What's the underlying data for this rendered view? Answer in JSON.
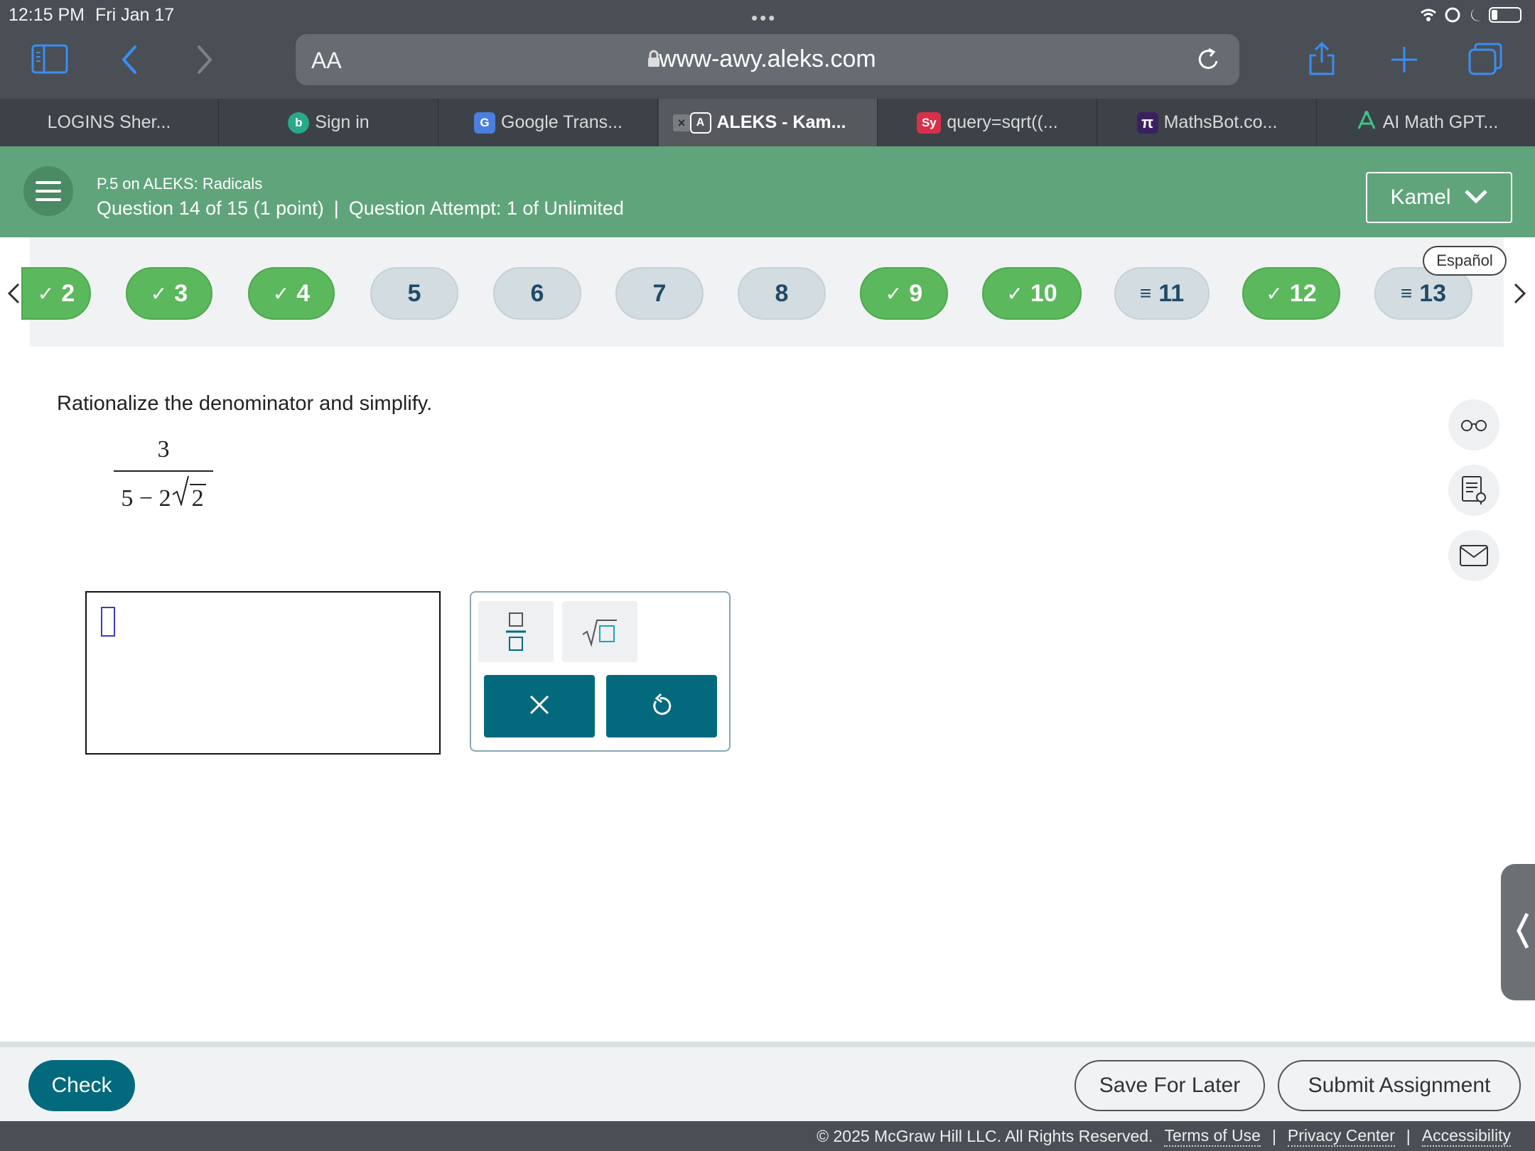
{
  "status_bar": {
    "time": "12:15 PM",
    "date": "Fri Jan 17",
    "dots": "•••"
  },
  "browser": {
    "text_size_label": "AA",
    "url": "www-awy.aleks.com",
    "tabs": [
      {
        "label": "LOGINS Sher...",
        "favicon": ""
      },
      {
        "label": "Sign in",
        "favicon": "b"
      },
      {
        "label": "Google Trans...",
        "favicon": "G"
      },
      {
        "label": "ALEKS - Kam...",
        "favicon": "A"
      },
      {
        "label": "query=sqrt((...",
        "favicon": "Sy"
      },
      {
        "label": "MathsBot.co...",
        "favicon": "π"
      },
      {
        "label": "AI Math GPT...",
        "favicon": ""
      }
    ]
  },
  "header": {
    "subtitle": "P.5 on ALEKS: Radicals",
    "question": "Question 14 of 15 (1 point)",
    "separator": "|",
    "attempt": "Question Attempt: 1 of Unlimited",
    "user": "Kamel"
  },
  "question_nav": {
    "items": [
      {
        "label": "2",
        "mark": "✓"
      },
      {
        "label": "3",
        "mark": "✓"
      },
      {
        "label": "4",
        "mark": "✓"
      },
      {
        "label": "5",
        "mark": ""
      },
      {
        "label": "6",
        "mark": ""
      },
      {
        "label": "7",
        "mark": ""
      },
      {
        "label": "8",
        "mark": ""
      },
      {
        "label": "9",
        "mark": "✓"
      },
      {
        "label": "10",
        "mark": "✓"
      },
      {
        "label": "11",
        "mark": "≡"
      },
      {
        "label": "12",
        "mark": "✓"
      },
      {
        "label": "13",
        "mark": "≡"
      }
    ],
    "language_toggle": "Español"
  },
  "question": {
    "prompt": "Rationalize the denominator and simplify.",
    "numerator": "3",
    "denominator_prefix": "5 − 2",
    "radicand": "2"
  },
  "palette": {
    "keys": [
      "fraction-key",
      "sqrt-key"
    ],
    "clear_icon": "×",
    "undo_icon": "↺"
  },
  "footer": {
    "check": "Check",
    "save": "Save For Later",
    "submit": "Submit Assignment",
    "copyright": "© 2025 McGraw Hill LLC. All Rights Reserved.",
    "terms": "Terms of Use",
    "privacy": "Privacy Center",
    "accessibility": "Accessibility",
    "sep": "|"
  },
  "colors": {
    "header_green": "#60a47b",
    "done_green": "#5cb85c",
    "teal": "#036a7e",
    "chrome": "#4a4f55"
  }
}
